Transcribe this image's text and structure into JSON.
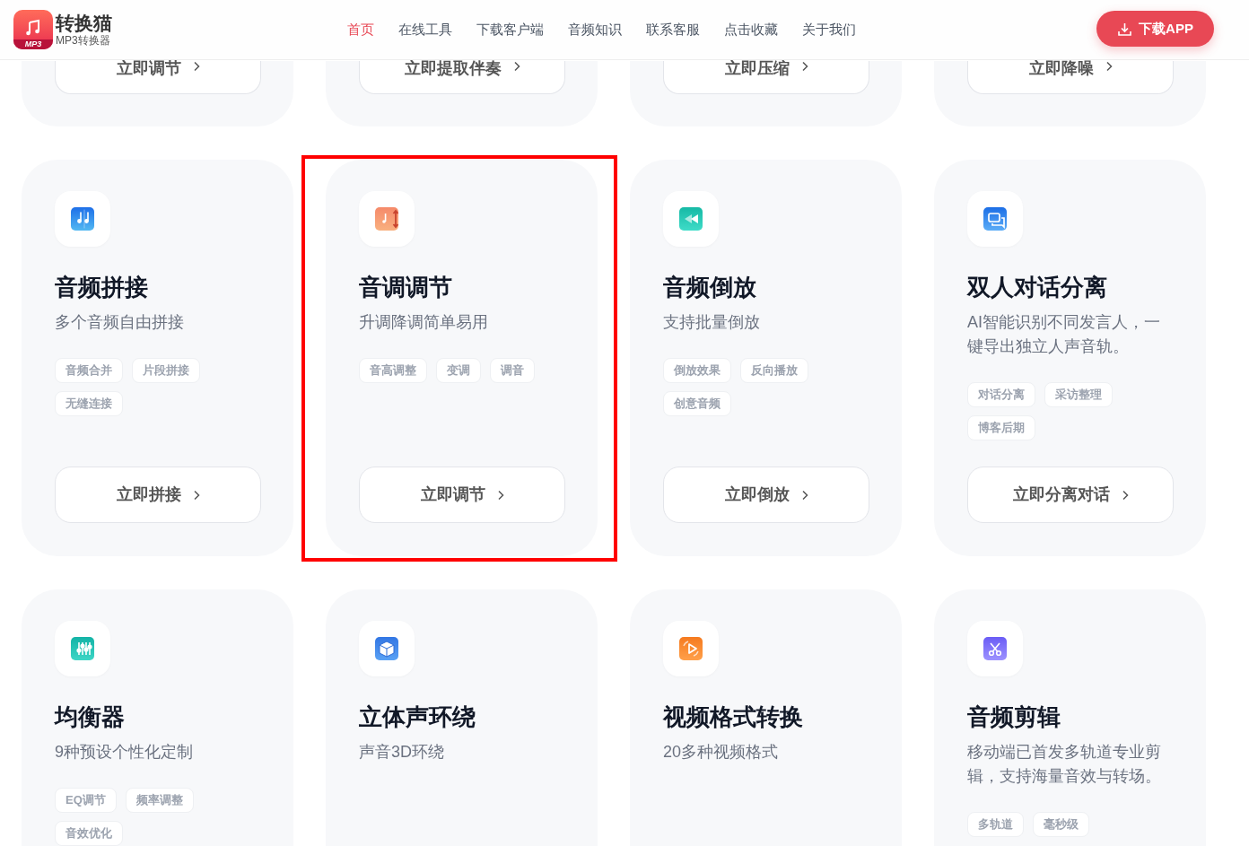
{
  "header": {
    "logo": {
      "badge": "MP3",
      "name": "转换猫",
      "subtitle": "MP3转换器"
    },
    "nav": [
      {
        "label": "首页",
        "selected": true
      },
      {
        "label": "在线工具",
        "selected": false
      },
      {
        "label": "下载客户端",
        "selected": false
      },
      {
        "label": "音频知识",
        "selected": false
      },
      {
        "label": "联系客服",
        "selected": false
      },
      {
        "label": "点击收藏",
        "selected": false
      },
      {
        "label": "关于我们",
        "selected": false
      }
    ],
    "download_button": "下载APP"
  },
  "partial_cards": [
    {
      "button": "立即调节"
    },
    {
      "button": "立即提取伴奏"
    },
    {
      "button": "立即压缩"
    },
    {
      "button": "立即降噪"
    }
  ],
  "cards": [
    {
      "kind": "notes",
      "title": "音频拼接",
      "description": "多个音频自由拼接",
      "tags": [
        "音频合并",
        "片段拼接",
        "无缝连接"
      ],
      "button": "立即拼接",
      "highlighted": false
    },
    {
      "kind": "pitch",
      "title": "音调调节",
      "description": "升调降调简单易用",
      "tags": [
        "音高调整",
        "变调",
        "调音"
      ],
      "button": "立即调节",
      "highlighted": true
    },
    {
      "kind": "rewind",
      "title": "音频倒放",
      "description": "支持批量倒放",
      "tags": [
        "倒放效果",
        "反向播放",
        "创意音频"
      ],
      "button": "立即倒放",
      "highlighted": false
    },
    {
      "kind": "chat",
      "title": "双人对话分离",
      "description": "AI智能识别不同发言人，一键导出独立人声音轨。",
      "tags": [
        "对话分离",
        "采访整理",
        "博客后期"
      ],
      "button": "立即分离对话",
      "highlighted": false
    },
    {
      "kind": "equalizer",
      "title": "均衡器",
      "description": "9种预设个性化定制",
      "tags": [
        "EQ调节",
        "频率调整",
        "音效优化"
      ],
      "highlighted": false
    },
    {
      "kind": "cube",
      "title": "立体声环绕",
      "description": "声音3D环绕",
      "highlighted": false
    },
    {
      "kind": "video",
      "title": "视频格式转换",
      "description": "20多种视频格式",
      "highlighted": false
    },
    {
      "kind": "scissors",
      "title": "音频剪辑",
      "description": "移动端已首发多轨道专业剪辑，支持海量音效与转场。",
      "tags": [
        "多轨道",
        "毫秒级"
      ],
      "highlighted": false
    }
  ]
}
